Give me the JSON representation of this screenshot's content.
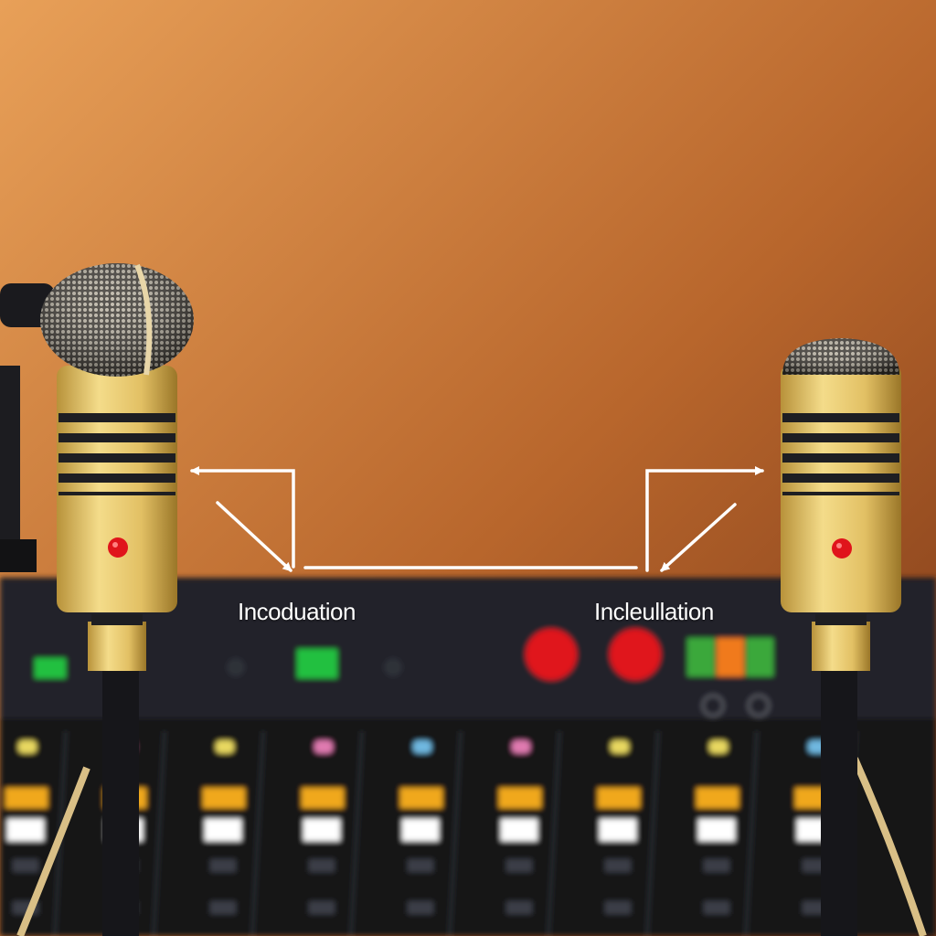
{
  "scene": {
    "background_top": "#e59a52",
    "background_bottom": "#8a4020",
    "mixer_color": "#1b1c22",
    "mic_gold": "#e8c96a",
    "mic_stripe": "#1e1e22",
    "indicator_red": "#e0141b",
    "arrow_color": "#ffffff"
  },
  "labels": {
    "left": "Incoduation",
    "right": "Incleullation"
  },
  "mixer": {
    "led_colors": [
      "#22c040",
      "#22c040",
      "#e0141b",
      "#e0141b"
    ],
    "meter_colors": [
      "#3aa83a",
      "#f07a1a",
      "#3aa83a"
    ],
    "fader_cap_colors": [
      "#f0a81e",
      "#ffffff"
    ],
    "knob_colors": [
      "#e8d860",
      "#e07ab0",
      "#e8d860",
      "#e07ab0",
      "#70b8e0",
      "#e07ab0",
      "#e8d860",
      "#e8d860",
      "#70b8e0"
    ]
  }
}
